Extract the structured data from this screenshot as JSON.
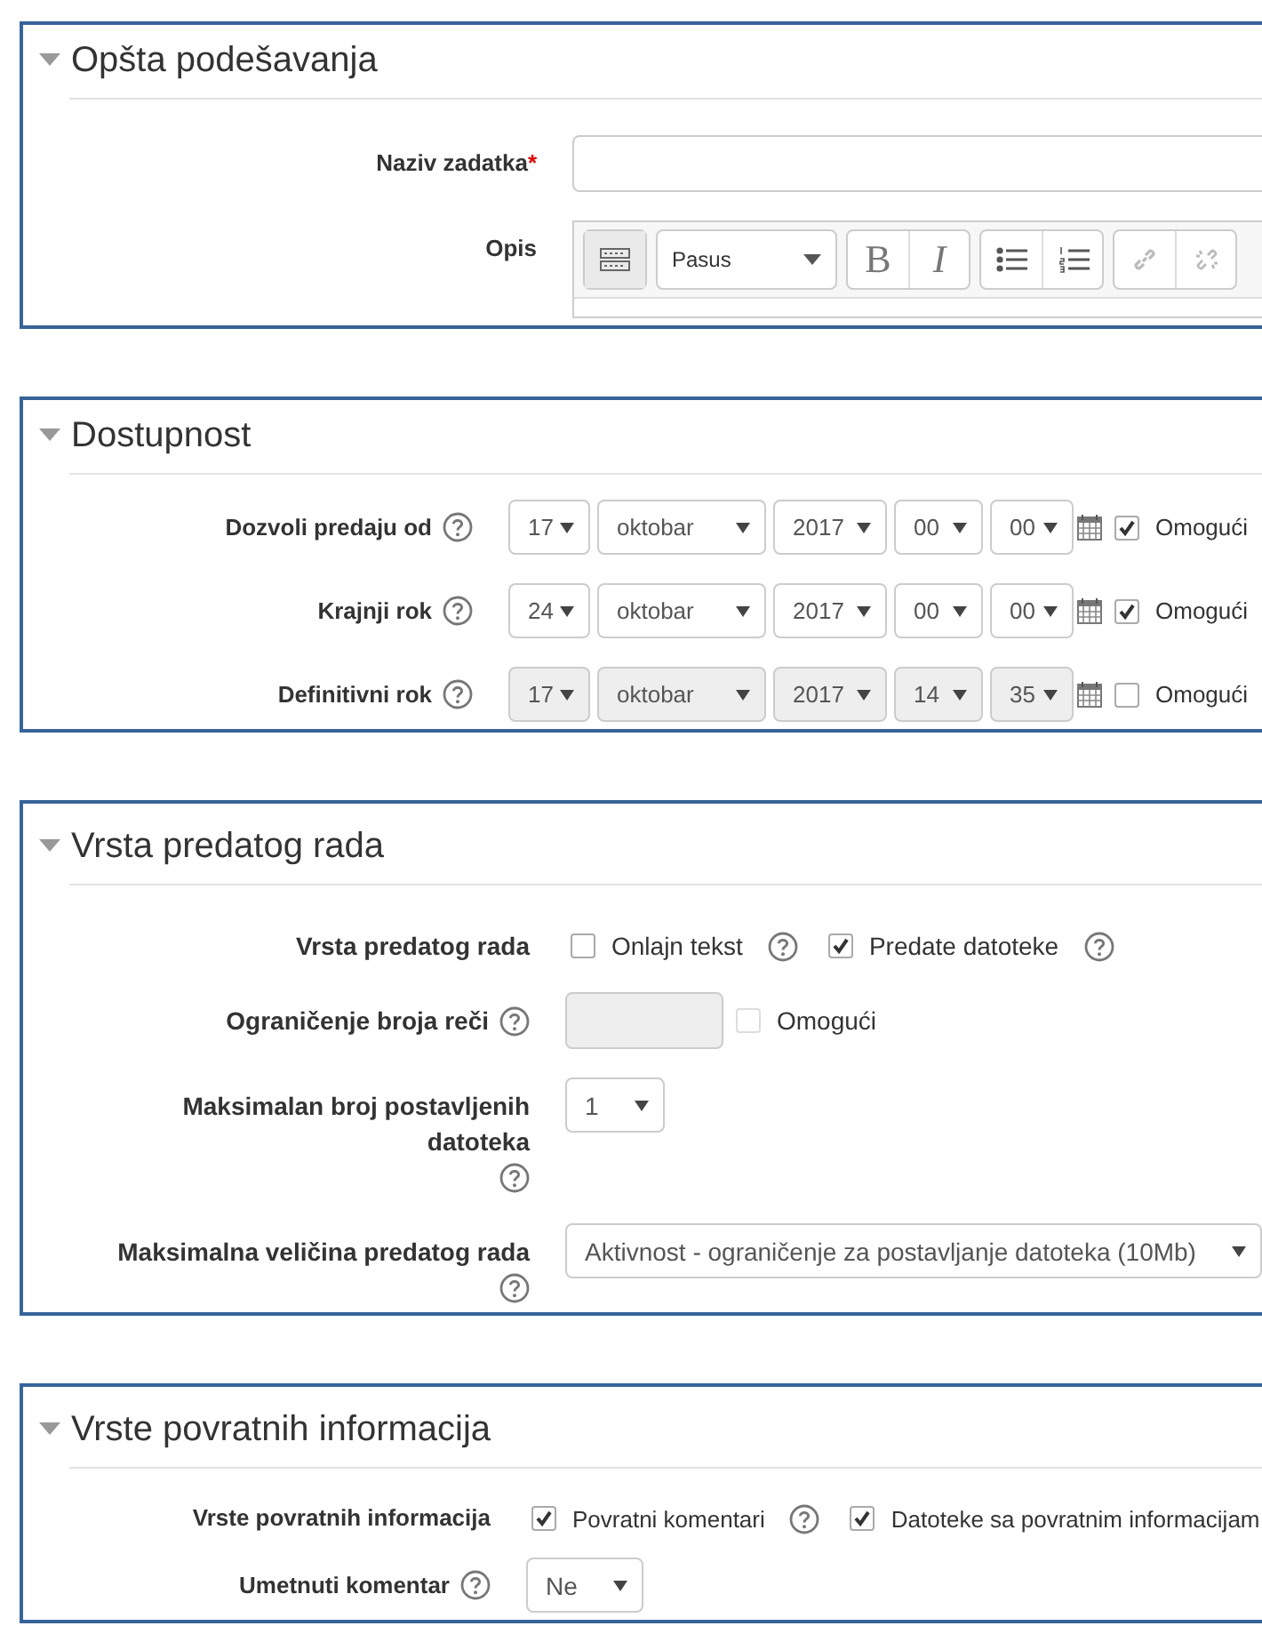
{
  "required_mark": "*",
  "sections": [
    {
      "title": "Opšta podešavanja",
      "expanded": true,
      "rows": [
        {
          "kind": "text",
          "label": "Naziv zadatka",
          "required": true
        },
        {
          "kind": "editor",
          "label": "Opis",
          "style_select": "Pasus",
          "bold_label": "B",
          "italic_label": "I"
        }
      ]
    },
    {
      "title": "Dostupnost",
      "expanded": true,
      "rows": [
        {
          "kind": "datetime",
          "label": "Dozvoli predaju od",
          "help": true,
          "fields": [
            "17",
            "oktobar",
            "2017",
            "00",
            "00"
          ],
          "enable": {
            "label": "Omogući",
            "checked": true
          }
        },
        {
          "kind": "datetime",
          "label": "Krajnji rok",
          "help": true,
          "fields": [
            "24",
            "oktobar",
            "2017",
            "00",
            "00"
          ],
          "enable": {
            "label": "Omogući",
            "checked": true
          }
        },
        {
          "kind": "datetime",
          "label": "Definitivni rok",
          "help": true,
          "fields": [
            "17",
            "oktobar",
            "2017",
            "14",
            "35"
          ],
          "enable": {
            "label": "Omogući",
            "checked": false
          }
        }
      ]
    },
    {
      "title": "Vrsta predatog rada",
      "expanded": true,
      "rows": [
        {
          "kind": "checks",
          "label": "Vrsta predatog rada",
          "help": false,
          "options": [
            {
              "label": "Onlajn tekst",
              "checked": false,
              "help": true
            },
            {
              "label": "Predate datoteke",
              "checked": true,
              "help": true
            }
          ]
        },
        {
          "kind": "number",
          "label": "Ograničenje broja reči",
          "help": true,
          "enable": {
            "label": "Omogući",
            "checked": false
          }
        },
        {
          "kind": "select",
          "label": "Maksimalan broj postavljenih datoteka",
          "help": true,
          "value": "1"
        },
        {
          "kind": "select",
          "label": "Maksimalna veličina predatog rada",
          "help": true,
          "value": "Aktivnost - ograničenje za postavljanje datoteka (10Mb)"
        }
      ]
    },
    {
      "title": "Vrste povratnih informacija",
      "expanded": true,
      "rows": [
        {
          "kind": "checks",
          "label": "Vrste povratnih informacija",
          "help": false,
          "options": [
            {
              "label": "Povratni komentari",
              "checked": true,
              "help": true
            },
            {
              "label": "Datoteke sa povratnim informacijam",
              "checked": true,
              "help": false
            }
          ]
        },
        {
          "kind": "select",
          "label": "Umetnuti komentar",
          "help": true,
          "value": "Ne"
        }
      ]
    }
  ]
}
